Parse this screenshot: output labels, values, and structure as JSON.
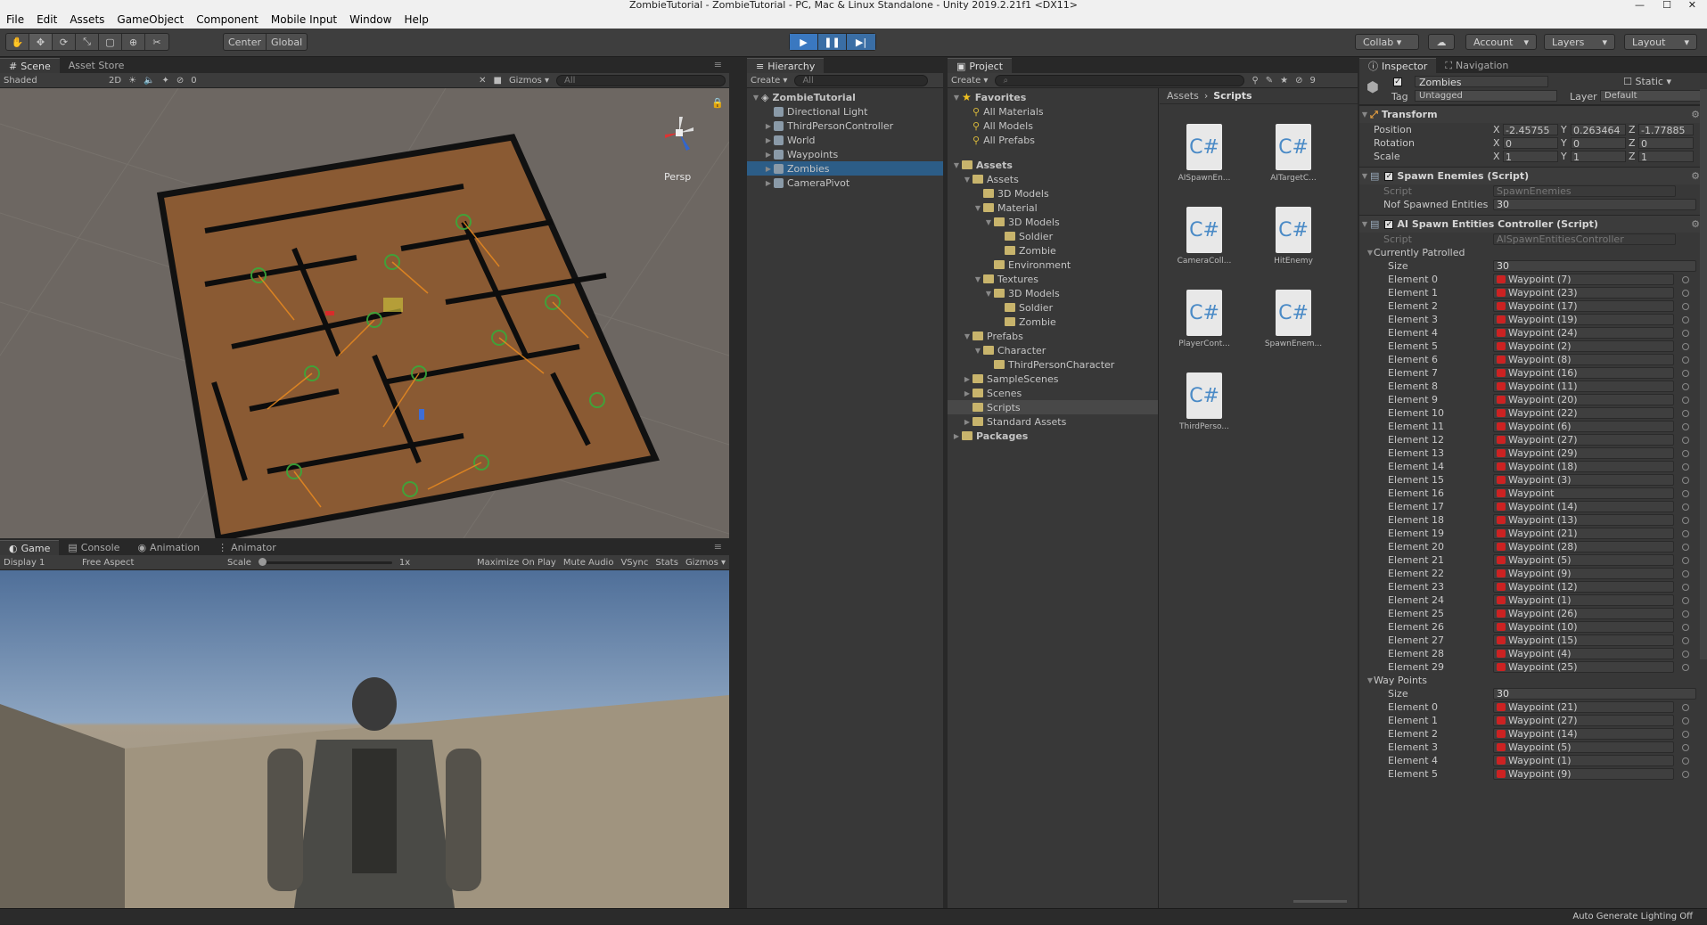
{
  "window_title": "ZombieTutorial - ZombieTutorial - PC, Mac & Linux Standalone - Unity 2019.2.21f1 <DX11>",
  "menu": [
    "File",
    "Edit",
    "Assets",
    "GameObject",
    "Component",
    "Mobile Input",
    "Window",
    "Help"
  ],
  "toolbar": {
    "pivot": "Center",
    "space": "Global",
    "collab": "Collab ▾",
    "account": "Account",
    "layers": "Layers",
    "layout": "Layout"
  },
  "scene": {
    "tabs": [
      "Scene",
      "Asset Store"
    ],
    "shading": "Shaded",
    "mode2d": "2D",
    "hidden_count": "0",
    "gizmos": "Gizmos",
    "search": "All",
    "persp": "Persp"
  },
  "game": {
    "tabs": [
      "Game",
      "Console",
      "Animation",
      "Animator"
    ],
    "display": "Display 1",
    "aspect": "Free Aspect",
    "scale_label": "Scale",
    "scale_value": "1x",
    "options": [
      "Maximize On Play",
      "Mute Audio",
      "VSync",
      "Stats",
      "Gizmos"
    ]
  },
  "hierarchy": {
    "tab": "Hierarchy",
    "create": "Create",
    "search": "All",
    "scene_name": "ZombieTutorial",
    "items": [
      {
        "label": "Directional Light",
        "expandable": false,
        "selected": false
      },
      {
        "label": "ThirdPersonController",
        "expandable": true,
        "selected": false
      },
      {
        "label": "World",
        "expandable": true,
        "selected": false
      },
      {
        "label": "Waypoints",
        "expandable": true,
        "selected": false
      },
      {
        "label": "Zombies",
        "expandable": true,
        "selected": true
      },
      {
        "label": "CameraPivot",
        "expandable": true,
        "selected": false
      }
    ]
  },
  "project": {
    "tab": "Project",
    "create": "Create",
    "favorites_label": "Favorites",
    "favorites": [
      "All Materials",
      "All Models",
      "All Prefabs"
    ],
    "assets_label": "Assets",
    "tree": [
      {
        "label": "Assets",
        "depth": 1,
        "arrow": "▼"
      },
      {
        "label": "3D Models",
        "depth": 2,
        "arrow": ""
      },
      {
        "label": "Material",
        "depth": 2,
        "arrow": "▼"
      },
      {
        "label": "3D Models",
        "depth": 3,
        "arrow": "▼"
      },
      {
        "label": "Soldier",
        "depth": 4,
        "arrow": ""
      },
      {
        "label": "Zombie",
        "depth": 4,
        "arrow": ""
      },
      {
        "label": "Environment",
        "depth": 3,
        "arrow": ""
      },
      {
        "label": "Textures",
        "depth": 2,
        "arrow": "▼"
      },
      {
        "label": "3D Models",
        "depth": 3,
        "arrow": "▼"
      },
      {
        "label": "Soldier",
        "depth": 4,
        "arrow": ""
      },
      {
        "label": "Zombie",
        "depth": 4,
        "arrow": ""
      },
      {
        "label": "Prefabs",
        "depth": 1,
        "arrow": "▼"
      },
      {
        "label": "Character",
        "depth": 2,
        "arrow": "▼"
      },
      {
        "label": "ThirdPersonCharacter",
        "depth": 3,
        "arrow": ""
      },
      {
        "label": "SampleScenes",
        "depth": 1,
        "arrow": "▶"
      },
      {
        "label": "Scenes",
        "depth": 1,
        "arrow": "▶"
      },
      {
        "label": "Scripts",
        "depth": 1,
        "arrow": ""
      },
      {
        "label": "Standard Assets",
        "depth": 1,
        "arrow": "▶"
      }
    ],
    "packages_label": "Packages",
    "breadcrumb": [
      "Assets",
      "Scripts"
    ],
    "files": [
      "AISpawnEn...",
      "AITargetC...",
      "CameraColl...",
      "HitEnemy",
      "PlayerCont...",
      "SpawnEnem...",
      "ThirdPerso..."
    ],
    "hidden_count": "9"
  },
  "inspector": {
    "tabs": [
      "Inspector",
      "Navigation"
    ],
    "object_name": "Zombies",
    "static_label": "Static",
    "tag_label": "Tag",
    "tag_value": "Untagged",
    "layer_label": "Layer",
    "layer_value": "Default",
    "transform": {
      "title": "Transform",
      "position": {
        "label": "Position",
        "x": "-2.45755",
        "y": "0.263464",
        "z": "-1.77885"
      },
      "rotation": {
        "label": "Rotation",
        "x": "0",
        "y": "0",
        "z": "0"
      },
      "scale": {
        "label": "Scale",
        "x": "1",
        "y": "1",
        "z": "1"
      }
    },
    "spawn_enemies": {
      "title": "Spawn Enemies (Script)",
      "script_label": "Script",
      "script_value": "SpawnEnemies",
      "nof_label": "Nof Spawned Entities",
      "nof_value": "30"
    },
    "ai_controller": {
      "title": "AI Spawn Entities Controller (Script)",
      "script_label": "Script",
      "script_value": "AISpawnEntitiesController",
      "patrolled_label": "Currently Patrolled",
      "size_label": "Size",
      "patrolled_size": "30",
      "patrolled": [
        "Waypoint (7)",
        "Waypoint (23)",
        "Waypoint (17)",
        "Waypoint (19)",
        "Waypoint (24)",
        "Waypoint (2)",
        "Waypoint (8)",
        "Waypoint (16)",
        "Waypoint (11)",
        "Waypoint (20)",
        "Waypoint (22)",
        "Waypoint (6)",
        "Waypoint (27)",
        "Waypoint (29)",
        "Waypoint (18)",
        "Waypoint (3)",
        "Waypoint",
        "Waypoint (14)",
        "Waypoint (13)",
        "Waypoint (21)",
        "Waypoint (28)",
        "Waypoint (5)",
        "Waypoint (9)",
        "Waypoint (12)",
        "Waypoint (1)",
        "Waypoint (26)",
        "Waypoint (10)",
        "Waypoint (15)",
        "Waypoint (4)",
        "Waypoint (25)"
      ],
      "waypoints_label": "Way Points",
      "waypoints_size": "30",
      "waypoints": [
        "Waypoint (21)",
        "Waypoint (27)",
        "Waypoint (14)",
        "Waypoint (5)",
        "Waypoint (1)",
        "Waypoint (9)"
      ]
    }
  },
  "status": "Auto Generate Lighting Off"
}
